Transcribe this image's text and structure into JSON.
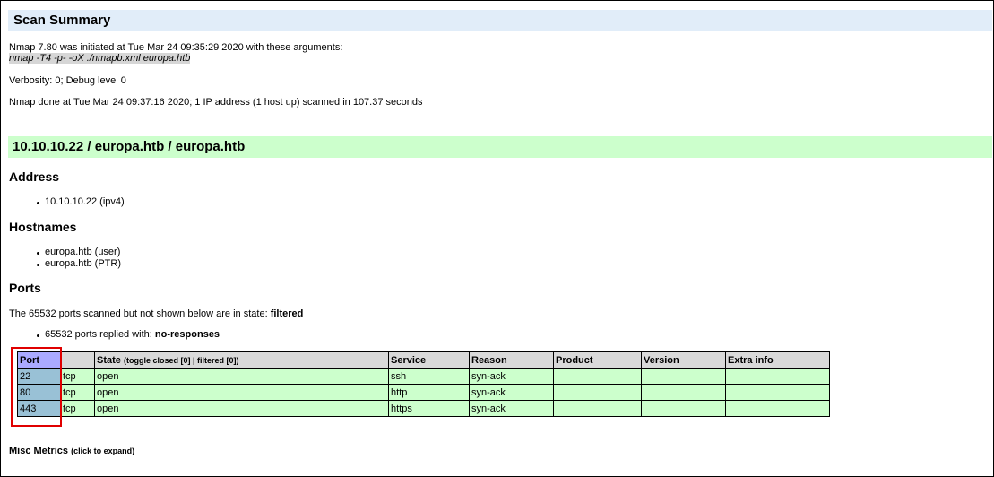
{
  "summary": {
    "title": "Scan Summary",
    "initiated": "Nmap 7.80 was initiated at Tue Mar 24 09:35:29 2020 with these arguments:",
    "arguments": "nmap -T4 -p- -oX ./nmapb.xml europa.htb",
    "verbosity": "Verbosity: 0; Debug level 0",
    "done": "Nmap done at Tue Mar 24 09:37:16 2020; 1 IP address (1 host up) scanned in 107.37 seconds"
  },
  "host": {
    "title": "10.10.10.22 / europa.htb / europa.htb",
    "address_heading": "Address",
    "addresses": [
      "10.10.10.22 (ipv4)"
    ],
    "hostnames_heading": "Hostnames",
    "hostnames": [
      "europa.htb (user)",
      "europa.htb (PTR)"
    ],
    "ports_heading": "Ports",
    "filtered_prefix": "The 65532 ports scanned but not shown below are in state: ",
    "filtered_state": "filtered",
    "replied_prefix": "65532 ports replied with: ",
    "replied_reason": "no-responses"
  },
  "ports_table": {
    "headers": {
      "port": "Port",
      "protocol": "",
      "state": "State",
      "toggle_open": "(",
      "toggle_closed": "toggle closed [0]",
      "toggle_sep": " | ",
      "toggle_filtered": "filtered [0]",
      "toggle_close": ")",
      "service": "Service",
      "reason": "Reason",
      "product": "Product",
      "version": "Version",
      "extra": "Extra info"
    },
    "rows": [
      {
        "port": "22",
        "protocol": "tcp",
        "state": "open",
        "service": "ssh",
        "reason": "syn-ack",
        "product": "",
        "version": "",
        "extra": ""
      },
      {
        "port": "80",
        "protocol": "tcp",
        "state": "open",
        "service": "http",
        "reason": "syn-ack",
        "product": "",
        "version": "",
        "extra": ""
      },
      {
        "port": "443",
        "protocol": "tcp",
        "state": "open",
        "service": "https",
        "reason": "syn-ack",
        "product": "",
        "version": "",
        "extra": ""
      }
    ]
  },
  "misc": {
    "label": "Misc Metrics",
    "hint": "(click to expand)"
  },
  "colors": {
    "summary_bg": "#e1edf9",
    "host_bg": "#ccffcc",
    "table_header_bg": "#d9d9d9",
    "port_header_bg": "#aaaaff",
    "port_cell_bg": "#99c1d6",
    "row_bg": "#ccffcc",
    "highlight_border": "#e00000"
  }
}
